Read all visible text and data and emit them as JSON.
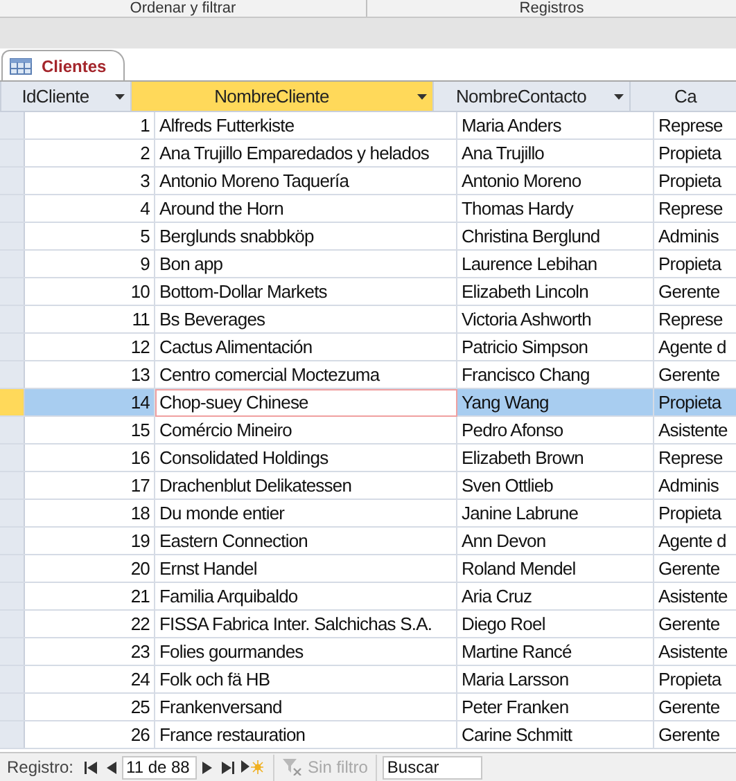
{
  "ribbon": {
    "groups": [
      "Ordenar y filtrar",
      "Registros"
    ]
  },
  "tab": {
    "label": "Clientes",
    "selected": true
  },
  "table": {
    "columns": [
      {
        "label": "IdCliente",
        "selected": false
      },
      {
        "label": "NombreCliente",
        "selected": true
      },
      {
        "label": "NombreContacto",
        "selected": false
      },
      {
        "label": "Ca",
        "selected": false
      }
    ],
    "rows": [
      {
        "id": "1",
        "cliente": "Alfreds Futterkiste",
        "contacto": "Maria Anders",
        "cargo": "Represe",
        "selected": false
      },
      {
        "id": "2",
        "cliente": "Ana Trujillo Emparedados y helados",
        "contacto": "Ana Trujillo",
        "cargo": "Propieta",
        "selected": false
      },
      {
        "id": "3",
        "cliente": "Antonio Moreno Taquería",
        "contacto": "Antonio Moreno",
        "cargo": "Propieta",
        "selected": false
      },
      {
        "id": "4",
        "cliente": "Around the Horn",
        "contacto": "Thomas Hardy",
        "cargo": "Represe",
        "selected": false
      },
      {
        "id": "5",
        "cliente": "Berglunds snabbköp",
        "contacto": "Christina Berglund",
        "cargo": "Adminis",
        "selected": false
      },
      {
        "id": "9",
        "cliente": "Bon app",
        "contacto": "Laurence Lebihan",
        "cargo": "Propieta",
        "selected": false
      },
      {
        "id": "10",
        "cliente": "Bottom-Dollar Markets",
        "contacto": "Elizabeth Lincoln",
        "cargo": "Gerente",
        "selected": false
      },
      {
        "id": "11",
        "cliente": "Bs Beverages",
        "contacto": "Victoria Ashworth",
        "cargo": "Represe",
        "selected": false
      },
      {
        "id": "12",
        "cliente": "Cactus Alimentación",
        "contacto": "Patricio Simpson",
        "cargo": "Agente d",
        "selected": false
      },
      {
        "id": "13",
        "cliente": "Centro comercial Moctezuma",
        "contacto": "Francisco Chang",
        "cargo": "Gerente",
        "selected": false
      },
      {
        "id": "14",
        "cliente": "Chop-suey Chinese",
        "contacto": "Yang Wang",
        "cargo": "Propieta",
        "selected": true
      },
      {
        "id": "15",
        "cliente": "Comércio Mineiro",
        "contacto": "Pedro Afonso",
        "cargo": "Asistente",
        "selected": false
      },
      {
        "id": "16",
        "cliente": "Consolidated Holdings",
        "contacto": "Elizabeth Brown",
        "cargo": "Represe",
        "selected": false
      },
      {
        "id": "17",
        "cliente": "Drachenblut Delikatessen",
        "contacto": "Sven Ottlieb",
        "cargo": "Adminis",
        "selected": false
      },
      {
        "id": "18",
        "cliente": "Du monde entier",
        "contacto": "Janine Labrune",
        "cargo": "Propieta",
        "selected": false
      },
      {
        "id": "19",
        "cliente": "Eastern Connection",
        "contacto": "Ann Devon",
        "cargo": "Agente d",
        "selected": false
      },
      {
        "id": "20",
        "cliente": "Ernst Handel",
        "contacto": "Roland Mendel",
        "cargo": "Gerente",
        "selected": false
      },
      {
        "id": "21",
        "cliente": "Familia Arquibaldo",
        "contacto": "Aria Cruz",
        "cargo": "Asistente",
        "selected": false
      },
      {
        "id": "22",
        "cliente": "FISSA Fabrica Inter. Salchichas S.A.",
        "contacto": "Diego Roel",
        "cargo": "Gerente",
        "selected": false
      },
      {
        "id": "23",
        "cliente": "Folies gourmandes",
        "contacto": "Martine Rancé",
        "cargo": "Asistente",
        "selected": false
      },
      {
        "id": "24",
        "cliente": "Folk och fä HB",
        "contacto": "Maria Larsson",
        "cargo": "Propieta",
        "selected": false
      },
      {
        "id": "25",
        "cliente": "Frankenversand",
        "contacto": "Peter Franken",
        "cargo": "Gerente",
        "selected": false
      },
      {
        "id": "26",
        "cliente": "France restauration",
        "contacto": "Carine Schmitt",
        "cargo": "Gerente",
        "selected": false
      }
    ]
  },
  "navigator": {
    "label": "Registro:",
    "position": "11 de 88",
    "filter": "Sin filtro",
    "search": {
      "placeholder": "Buscar"
    }
  }
}
